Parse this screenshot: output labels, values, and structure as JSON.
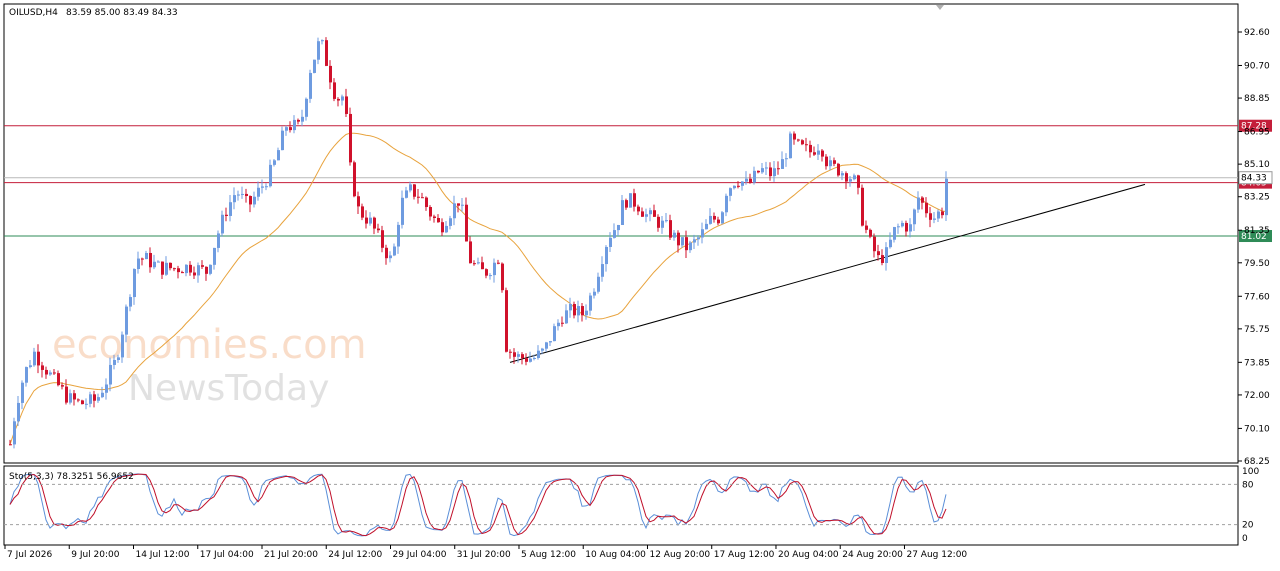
{
  "header": {
    "symbol_label": "OILUSD,H4",
    "ohlc_label": "83.59 85.00 83.49 84.33"
  },
  "stoch": {
    "label": "Sto(5,3,3) 78.3251 56.9652",
    "levels": [
      "100",
      "80",
      "20",
      "0"
    ]
  },
  "watermark": {
    "line1": "economies.com",
    "line2": "NewsToday"
  },
  "colors": {
    "bull": "#6E9BE0",
    "bear": "#D0112B",
    "ma": "#E8A33D",
    "resistance": "#C41E3A",
    "support": "#2E8B57",
    "trendline": "#000000",
    "stoch_main": "#5B8FD8",
    "stoch_signal": "#C0102A"
  },
  "chart_data": {
    "type": "candlestick",
    "symbol": "OILUSD",
    "timeframe": "H4",
    "ohlc": {
      "open": 83.59,
      "high": 85.0,
      "low": 83.49,
      "close": 84.33
    },
    "price_axis": {
      "ticks": [
        "92.60",
        "90.70",
        "88.85",
        "86.95",
        "85.10",
        "83.25",
        "81.35",
        "79.50",
        "77.60",
        "75.75",
        "73.85",
        "72.00",
        "70.10",
        "68.25"
      ],
      "range": [
        68.25,
        92.6
      ]
    },
    "time_axis": {
      "ticks": [
        "7 Jul 2026",
        "9 Jul 20:00",
        "14 Jul 12:00",
        "17 Jul 04:00",
        "21 Jul 20:00",
        "24 Jul 12:00",
        "29 Jul 04:00",
        "31 Jul 20:00",
        "5 Aug 12:00",
        "10 Aug 04:00",
        "12 Aug 20:00",
        "17 Aug 12:00",
        "20 Aug 04:00",
        "24 Aug 20:00",
        "27 Aug 12:00"
      ]
    },
    "horizontal_levels": [
      {
        "price": 87.28,
        "label": "87.28",
        "kind": "resistance"
      },
      {
        "price": 84.05,
        "label": "84.05",
        "kind": "resistance"
      },
      {
        "price": 81.02,
        "label": "81.02",
        "kind": "support"
      }
    ],
    "close_marker": {
      "price": 84.33,
      "label": "84.33"
    },
    "trendline": {
      "from": {
        "time": "4 Aug 2026",
        "price": 73.85
      },
      "to": {
        "time": "29 Aug 2026",
        "price": 83.95
      }
    },
    "path_points": [
      [
        0,
        69.2
      ],
      [
        6,
        71.5
      ],
      [
        14,
        73.2
      ],
      [
        24,
        74.4
      ],
      [
        34,
        73.6
      ],
      [
        44,
        72.8
      ],
      [
        58,
        71.8
      ],
      [
        70,
        71.5
      ],
      [
        86,
        71.7
      ],
      [
        96,
        72.8
      ],
      [
        106,
        74.0
      ],
      [
        116,
        76.8
      ],
      [
        126,
        79.8
      ],
      [
        136,
        79.7
      ],
      [
        150,
        79.2
      ],
      [
        166,
        79.2
      ],
      [
        180,
        79.3
      ],
      [
        196,
        79.0
      ],
      [
        206,
        80.9
      ],
      [
        216,
        82.5
      ],
      [
        226,
        83.6
      ],
      [
        238,
        82.7
      ],
      [
        250,
        83.7
      ],
      [
        262,
        84.8
      ],
      [
        276,
        87.3
      ],
      [
        290,
        87.2
      ],
      [
        300,
        90.5
      ],
      [
        310,
        92.2
      ],
      [
        318,
        90.5
      ],
      [
        326,
        88.8
      ],
      [
        334,
        89.0
      ],
      [
        340,
        84.8
      ],
      [
        348,
        82.5
      ],
      [
        360,
        81.8
      ],
      [
        372,
        80.5
      ],
      [
        382,
        79.5
      ],
      [
        390,
        82.8
      ],
      [
        400,
        83.6
      ],
      [
        410,
        83.3
      ],
      [
        420,
        82.3
      ],
      [
        430,
        81.5
      ],
      [
        440,
        82.4
      ],
      [
        450,
        83.2
      ],
      [
        458,
        79.8
      ],
      [
        466,
        79.2
      ],
      [
        474,
        78.9
      ],
      [
        482,
        79.3
      ],
      [
        490,
        80.0
      ],
      [
        496,
        74.8
      ],
      [
        504,
        74.2
      ],
      [
        514,
        74.1
      ],
      [
        524,
        74.1
      ],
      [
        534,
        74.5
      ],
      [
        542,
        75.5
      ],
      [
        552,
        76.5
      ],
      [
        562,
        76.8
      ],
      [
        572,
        76.6
      ],
      [
        582,
        77.8
      ],
      [
        590,
        79.5
      ],
      [
        598,
        81.0
      ],
      [
        606,
        81.6
      ],
      [
        614,
        83.1
      ],
      [
        626,
        82.9
      ],
      [
        636,
        82.2
      ],
      [
        646,
        81.9
      ],
      [
        656,
        81.5
      ],
      [
        666,
        80.8
      ],
      [
        678,
        80.3
      ],
      [
        690,
        81.0
      ],
      [
        700,
        81.9
      ],
      [
        710,
        82.1
      ],
      [
        716,
        83.6
      ],
      [
        726,
        84.3
      ],
      [
        738,
        83.9
      ],
      [
        750,
        84.8
      ],
      [
        762,
        84.5
      ],
      [
        772,
        85.2
      ],
      [
        780,
        86.4
      ],
      [
        790,
        86.0
      ],
      [
        800,
        85.8
      ],
      [
        810,
        86.3
      ],
      [
        818,
        85.0
      ],
      [
        828,
        84.8
      ],
      [
        838,
        84.5
      ],
      [
        846,
        84.0
      ],
      [
        852,
        82.0
      ],
      [
        860,
        80.6
      ],
      [
        868,
        79.7
      ],
      [
        876,
        80.0
      ],
      [
        884,
        81.3
      ],
      [
        892,
        81.7
      ],
      [
        900,
        81.5
      ],
      [
        908,
        83.2
      ],
      [
        916,
        82.5
      ],
      [
        924,
        82.1
      ],
      [
        932,
        82.5
      ],
      [
        936,
        84.3
      ]
    ],
    "stochastic": {
      "period": "5,3,3",
      "main": 78.3251,
      "signal": 56.9652,
      "levels": [
        20,
        80
      ],
      "range": [
        0,
        100
      ]
    }
  }
}
